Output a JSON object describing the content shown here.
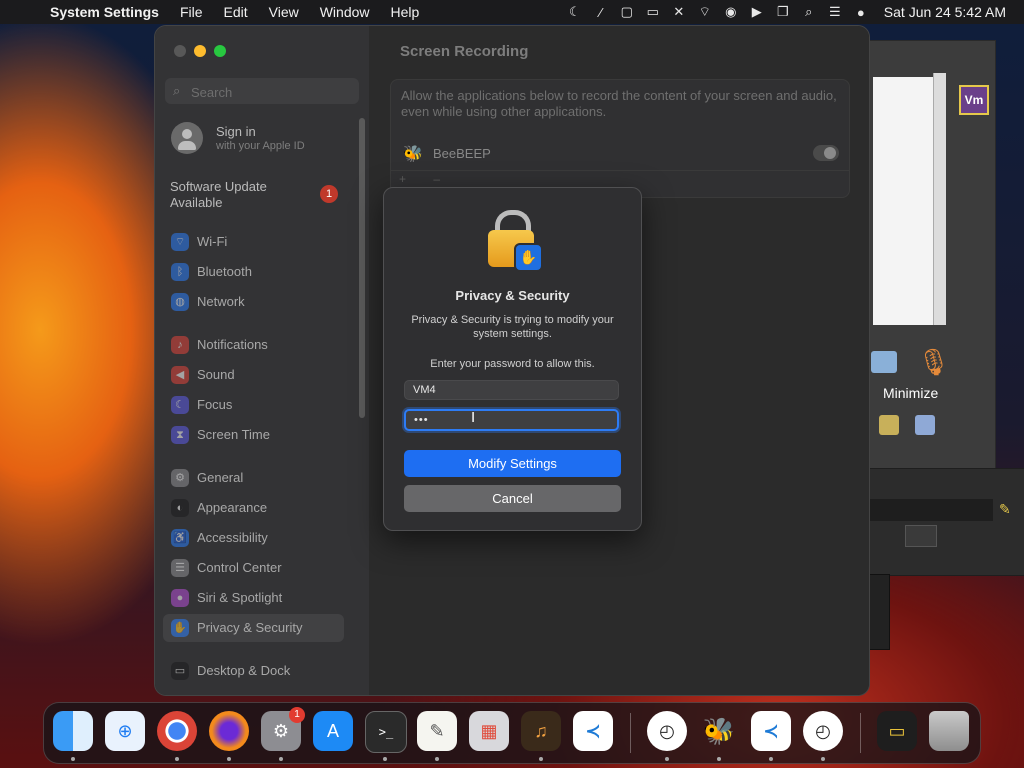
{
  "menubar": {
    "app_name": "System Settings",
    "menus": [
      "File",
      "Edit",
      "View",
      "Window",
      "Help"
    ],
    "clock": "Sat Jun 24  5:42 AM"
  },
  "sidebar": {
    "search_placeholder": "Search",
    "signin_title": "Sign in",
    "signin_subtitle": "with your Apple ID",
    "update_line1": "Software Update",
    "update_line2": "Available",
    "update_badge": "1",
    "items": [
      {
        "label": "Wi-Fi",
        "icon": "wifi-icon",
        "color": "#2a7cf6"
      },
      {
        "label": "Bluetooth",
        "icon": "bluetooth-icon",
        "color": "#2a7cf6"
      },
      {
        "label": "Network",
        "icon": "globe-icon",
        "color": "#2a7cf6"
      },
      {
        "label": "Notifications",
        "icon": "bell-icon",
        "color": "#e0443b"
      },
      {
        "label": "Sound",
        "icon": "speaker-icon",
        "color": "#e0443b"
      },
      {
        "label": "Focus",
        "icon": "moon-icon",
        "color": "#5e5ce6"
      },
      {
        "label": "Screen Time",
        "icon": "hourglass-icon",
        "color": "#5e5ce6"
      },
      {
        "label": "General",
        "icon": "gear-icon",
        "color": "#8e8e93"
      },
      {
        "label": "Appearance",
        "icon": "appearance-icon",
        "color": "#1c1c1e"
      },
      {
        "label": "Accessibility",
        "icon": "accessibility-icon",
        "color": "#2a7cf6"
      },
      {
        "label": "Control Center",
        "icon": "control-center-icon",
        "color": "#8e8e93"
      },
      {
        "label": "Siri & Spotlight",
        "icon": "siri-icon",
        "color": "#b44fd6"
      },
      {
        "label": "Privacy & Security",
        "icon": "hand-icon",
        "color": "#2a7cf6"
      },
      {
        "label": "Desktop & Dock",
        "icon": "dock-icon",
        "color": "#1c1c1e"
      }
    ],
    "selected": "Privacy & Security"
  },
  "content": {
    "title": "Screen Recording",
    "description": "Allow the applications below to record the content of your screen and audio, even while using other applications.",
    "apps": [
      {
        "name": "BeeBEEP",
        "enabled": false
      }
    ],
    "add_remove": "+ –"
  },
  "dialog": {
    "title": "Privacy & Security",
    "message": "Privacy & Security is trying to modify your system settings.",
    "prompt": "Enter your password to allow this.",
    "username": "VM4",
    "password_mask": "•••",
    "primary_button": "Modify Settings",
    "secondary_button": "Cancel"
  },
  "background_app": {
    "vm_label": "Vm",
    "minimize_label": "Minimize"
  },
  "dock": {
    "badge_settings": "1",
    "apps": [
      "Finder",
      "Safari",
      "Chrome",
      "Firefox",
      "System Settings",
      "App Store",
      "Terminal",
      "TextEdit",
      "Launchpad",
      "GarageBand",
      "Visual Studio Code",
      "Clock",
      "BeeBEEP",
      "Visual Studio Code",
      "Clock",
      "Screenshot",
      "Trash"
    ]
  }
}
